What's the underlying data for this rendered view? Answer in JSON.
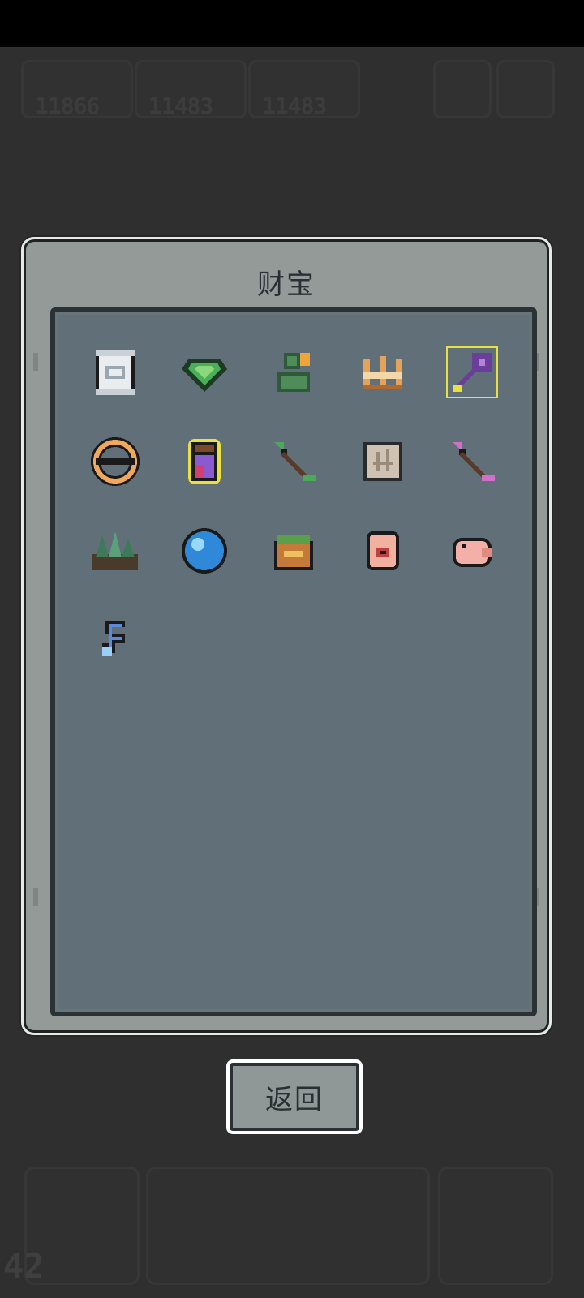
{
  "hud": {
    "counts": [
      "11866",
      "11483",
      "11483"
    ],
    "level": "42"
  },
  "dialog": {
    "title": "财宝",
    "items": [
      {
        "icon": "scroll-icon"
      },
      {
        "icon": "green-gem-icon"
      },
      {
        "icon": "green-bust-icon"
      },
      {
        "icon": "golden-crown-icon"
      },
      {
        "icon": "purple-key-icon"
      },
      {
        "icon": "ring-compass-icon"
      },
      {
        "icon": "potion-jar-icon"
      },
      {
        "icon": "green-arrow-icon"
      },
      {
        "icon": "old-map-icon"
      },
      {
        "icon": "pink-arrow-icon"
      },
      {
        "icon": "spiky-rock-icon"
      },
      {
        "icon": "blue-orb-icon"
      },
      {
        "icon": "treasure-chest-icon"
      },
      {
        "icon": "eye-hand-icon"
      },
      {
        "icon": "piggy-bank-icon"
      },
      {
        "icon": "blue-wisp-icon"
      }
    ]
  },
  "back_label": "返回"
}
